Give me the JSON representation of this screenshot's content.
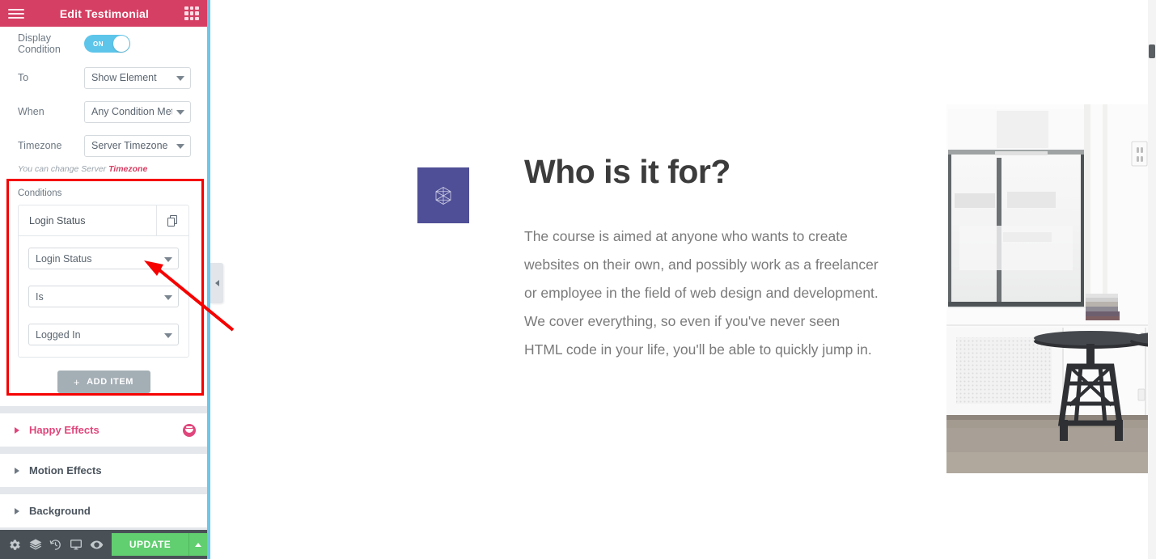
{
  "panel": {
    "header": {
      "title": "Edit Testimonial",
      "menu_icon": "hamburger-icon",
      "widgets_icon": "grid-icon",
      "bg_color": "#d53f63"
    },
    "display_condition": {
      "label": "Display Condition",
      "toggle_state": "ON"
    },
    "fields": [
      {
        "label": "To",
        "value": "Show Element"
      },
      {
        "label": "When",
        "value": "Any Condition Met"
      },
      {
        "label": "Timezone",
        "value": "Server Timezone"
      }
    ],
    "note": {
      "prefix": "You can change Server ",
      "link": "Timezone"
    },
    "conditions": {
      "label": "Conditions",
      "item_title": "Login Status",
      "duplicate_icon": "copy-icon",
      "selects": [
        {
          "name": "condition-type",
          "value": "Login Status"
        },
        {
          "name": "condition-operator",
          "value": "Is"
        },
        {
          "name": "condition-value",
          "value": "Logged In"
        }
      ],
      "add_item_label": "ADD ITEM",
      "add_item_plus": "+"
    },
    "sections": [
      {
        "title": "Happy Effects",
        "accent": true,
        "icon": "happy-face-icon"
      },
      {
        "title": "Motion Effects",
        "accent": false,
        "icon": null
      },
      {
        "title": "Background",
        "accent": false,
        "icon": null
      }
    ],
    "footer": {
      "icons": [
        "gear-icon",
        "layers-icon",
        "history-icon",
        "monitor-icon",
        "eye-icon"
      ],
      "update_label": "UPDATE",
      "update_color": "#61ce70",
      "caret_icon": "caret-up-icon"
    },
    "collapse_handle_icon": "chevron-left-icon"
  },
  "canvas": {
    "icon_widget": {
      "name": "hexagon-icon",
      "bg_color": "#4f4f97"
    },
    "heading": "Who is it for?",
    "paragraph": "The course is aimed at anyone who wants to create websites on their own, and possibly work as a freelancer or employee in the field of web design and development. We cover everything, so even if you've never seen HTML code in your life, you'll be able to quickly jump in.",
    "photo_alt": "Bright office interior with two black stools in front of large windows"
  },
  "annotations": {
    "highlight_box_color": "#f60000",
    "arrow_color": "#f60000"
  }
}
